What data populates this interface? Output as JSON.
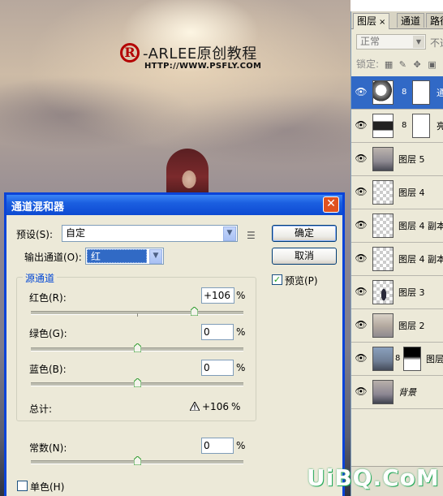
{
  "canvas": {
    "logo_mark": "R",
    "logo_text": "-ARLEE原创教程",
    "logo_url": "HTTP://WWW.PSFLY.COM"
  },
  "layers_panel": {
    "tabs": [
      {
        "label": "图层",
        "close": "×"
      },
      {
        "label": "通道"
      },
      {
        "label": "路径"
      }
    ],
    "blend_mode": "正常",
    "opacity_label": "不透",
    "lock_label": "锁定:",
    "layers": [
      {
        "name": "通道",
        "selected": true,
        "has_mask": true
      },
      {
        "name": "亮度",
        "selected": false,
        "has_mask": true
      },
      {
        "name": "图层 5",
        "selected": false
      },
      {
        "name": "图层 4",
        "selected": false
      },
      {
        "name": "图层 4 副本",
        "selected": false
      },
      {
        "name": "图层 4 副本",
        "selected": false
      },
      {
        "name": "图层 3",
        "selected": false
      },
      {
        "name": "图层 2",
        "selected": false
      },
      {
        "name": "图层",
        "selected": false,
        "has_mask": true
      },
      {
        "name": "背景",
        "selected": false
      }
    ]
  },
  "dialog": {
    "title": "通道混和器",
    "close": "✕",
    "preset_label": "预设(S):",
    "preset_value": "自定",
    "output_label": "输出通道(O):",
    "output_value": "红",
    "ok_label": "确定",
    "cancel_label": "取消",
    "preview_label": "预览(P)",
    "preview_checked": true,
    "source_group": "源通道",
    "channels": [
      {
        "label": "红色(R):",
        "value": "+106",
        "unit": "%",
        "level": 106
      },
      {
        "label": "绿色(G):",
        "value": "0",
        "unit": "%",
        "level": 0
      },
      {
        "label": "蓝色(B):",
        "value": "0",
        "unit": "%",
        "level": 0
      }
    ],
    "total_label": "总计:",
    "total_value": "+106",
    "total_unit": "%",
    "constant_label": "常数(N):",
    "constant_value": "0",
    "constant_unit": "%",
    "monochrome_label": "单色(H)",
    "monochrome_checked": false
  },
  "watermark": "UiBQ.CoM"
}
